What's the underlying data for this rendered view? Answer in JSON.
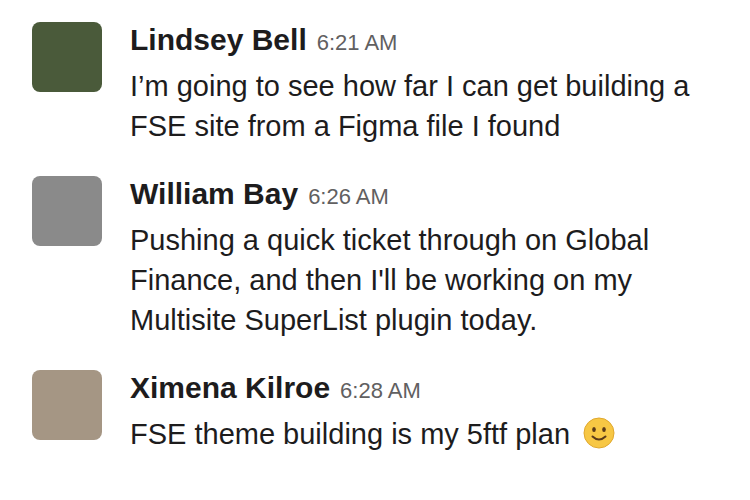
{
  "messages": [
    {
      "author": "Lindsey Bell",
      "time": "6:21 AM",
      "text": "I’m going to see how far I can get building a FSE site from a Figma file I found",
      "avatar_color": "#4a5a3a"
    },
    {
      "author": "William Bay",
      "time": "6:26 AM",
      "text": "Pushing a quick ticket through on Global Finance, and then I'll be working on my Multisite SuperList plugin today.",
      "avatar_color": "#8a8a8a"
    },
    {
      "author": "Ximena Kilroe",
      "time": "6:28 AM",
      "text": "FSE theme building is my 5ftf plan",
      "avatar_color": "#a59684"
    }
  ]
}
